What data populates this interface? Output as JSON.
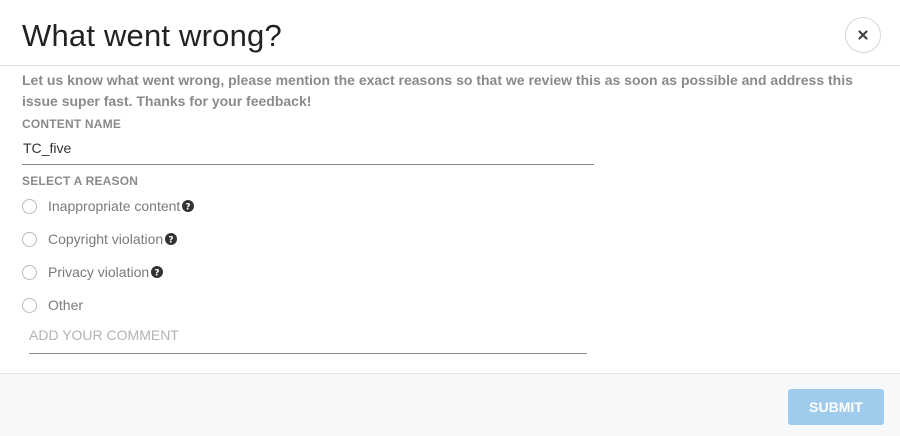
{
  "dialog": {
    "title": "What went wrong?",
    "description": "Let us know what went wrong, please mention the exact reasons so that we review this as soon as possible and address this issue super fast. Thanks for your feedback!"
  },
  "content_name": {
    "label": "CONTENT NAME",
    "value": "TC_five"
  },
  "reason": {
    "label": "SELECT A REASON",
    "options": [
      {
        "label": "Inappropriate content",
        "has_help": true,
        "selected": false
      },
      {
        "label": "Copyright violation",
        "has_help": true,
        "selected": false
      },
      {
        "label": "Privacy violation",
        "has_help": true,
        "selected": false
      },
      {
        "label": "Other",
        "has_help": false,
        "selected": false
      }
    ]
  },
  "comment": {
    "placeholder": "ADD YOUR COMMENT",
    "value": ""
  },
  "footer": {
    "submit_label": "SUBMIT",
    "submit_enabled": false
  },
  "icons": {
    "close": "close-icon",
    "help": "question-circle-icon"
  },
  "colors": {
    "submit_bg": "#9fcbed",
    "footer_bg": "#f7f8fa",
    "muted_text": "#8a8a8a"
  }
}
